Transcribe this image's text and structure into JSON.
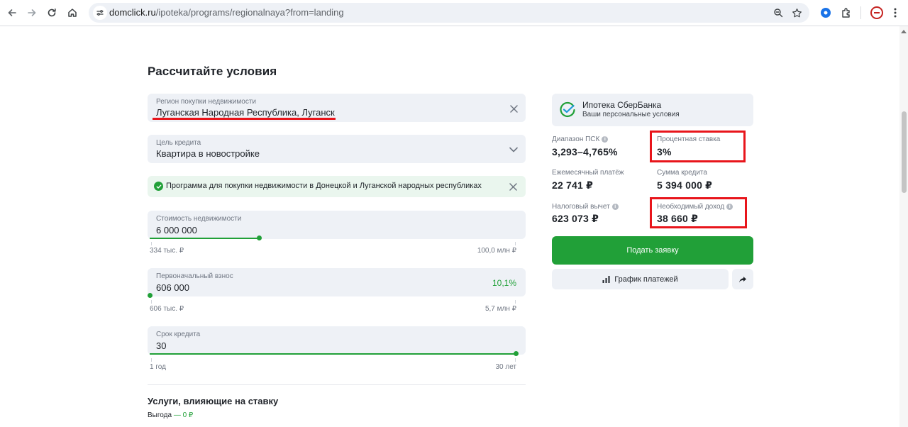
{
  "browser": {
    "url_host": "domclick.ru",
    "url_path": "/ipoteka/programs/regionalnaya?from=landing"
  },
  "page": {
    "title": "Рассчитайте условия"
  },
  "region": {
    "label": "Регион покупки недвижимости",
    "value": "Луганская Народная Республика, Луганск"
  },
  "purpose": {
    "label": "Цель кредита",
    "value": "Квартира в новостройке"
  },
  "notice": {
    "text": "Программа для покупки недвижимости в Донецкой и Луганской народных республиках"
  },
  "property_cost": {
    "label": "Стоимость недвижимости",
    "value": "6 000 000",
    "min_label": "334 тыс. ₽",
    "max_label": "100,0 млн ₽",
    "slider_fraction": 0.3
  },
  "down_payment": {
    "label": "Первоначальный взнос",
    "value": "606 000",
    "percent": "10,1%",
    "min_label": "606 тыс. ₽",
    "max_label": "5,7 млн ₽",
    "slider_fraction": 0.0
  },
  "term": {
    "label": "Срок кредита",
    "value": "30",
    "min_label": "1 год",
    "max_label": "30 лет",
    "slider_fraction": 1.0
  },
  "services": {
    "title": "Услуги, влияющие на ставку",
    "benefit_label": "Выгода",
    "benefit_value": "— 0 ₽"
  },
  "bank": {
    "name": "Ипотека СберБанка",
    "subtitle": "Ваши персональные условия"
  },
  "stats": {
    "psk_label": "Диапазон ПСК",
    "psk_value": "3,293–4,765%",
    "rate_label": "Процентная ставка",
    "rate_value": "3%",
    "payment_label": "Ежемесячный платёж",
    "payment_value": "22 741 ₽",
    "loan_label": "Сумма кредита",
    "loan_value": "5 394 000 ₽",
    "tax_label": "Налоговый вычет",
    "tax_value": "623 073 ₽",
    "income_label": "Необходимый доход",
    "income_value": "38 660 ₽"
  },
  "actions": {
    "apply_label": "Подать заявку",
    "schedule_label": "График платежей"
  },
  "colors": {
    "accent_green": "#21a038",
    "highlight_red": "#e8151b",
    "field_bg": "#eef1f6"
  }
}
